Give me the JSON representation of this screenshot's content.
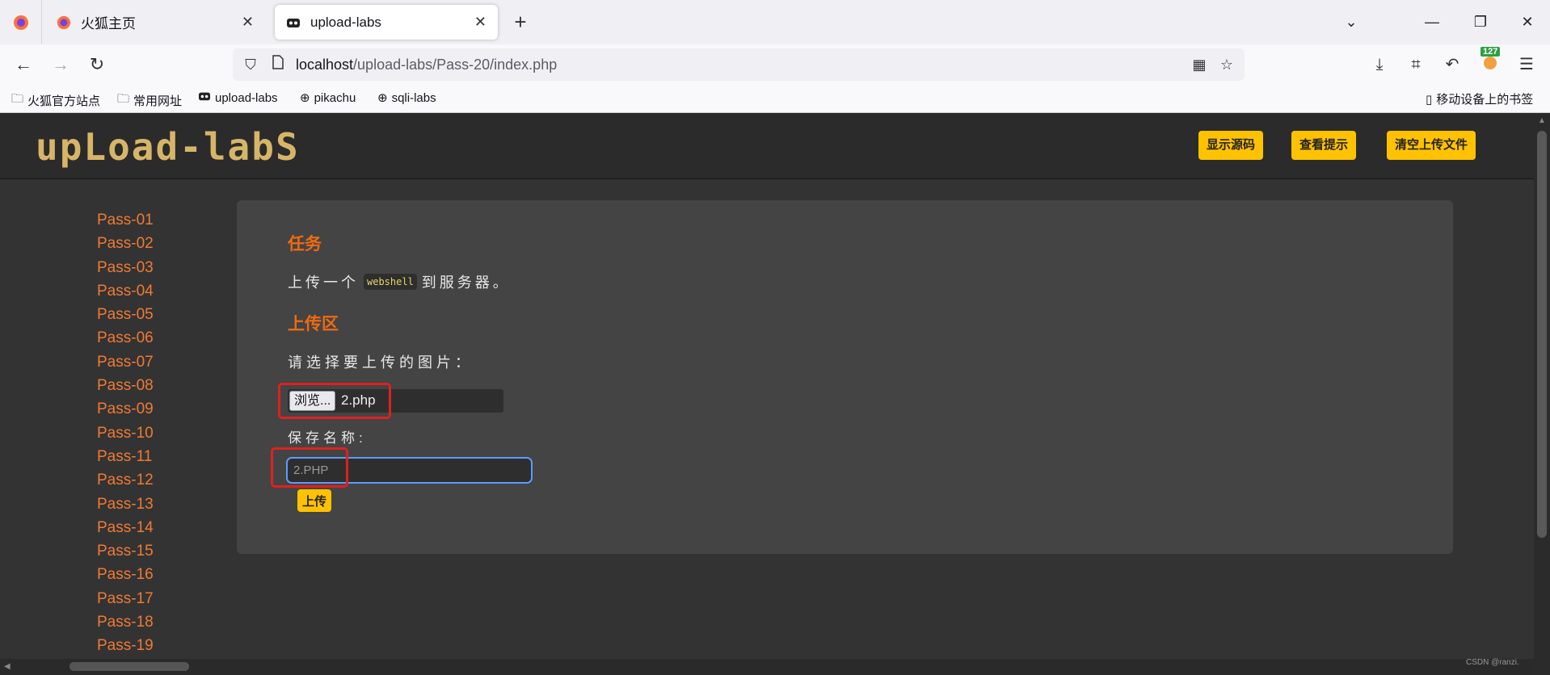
{
  "tabs": [
    {
      "title": "火狐主页",
      "icon": "firefox-icon"
    },
    {
      "title": "upload-labs",
      "icon": "game-icon"
    }
  ],
  "url": {
    "host": "localhost",
    "path": "/upload-labs/Pass-20/index.php"
  },
  "toolbar": {
    "badge_count": "127"
  },
  "bookmarks": [
    {
      "label": "火狐官方站点",
      "icon": "folder-icon"
    },
    {
      "label": "常用网址",
      "icon": "folder-icon"
    },
    {
      "label": "upload-labs",
      "icon": "game-icon"
    },
    {
      "label": "pikachu",
      "icon": "globe-icon"
    },
    {
      "label": "sqli-labs",
      "icon": "globe-icon"
    }
  ],
  "mobile_bookmarks": "移动设备上的书签",
  "header": {
    "logo": "upLoad-labS",
    "buttons": [
      "显示源码",
      "查看提示",
      "清空上传文件"
    ]
  },
  "sidebar": {
    "items": [
      "Pass-01",
      "Pass-02",
      "Pass-03",
      "Pass-04",
      "Pass-05",
      "Pass-06",
      "Pass-07",
      "Pass-08",
      "Pass-09",
      "Pass-10",
      "Pass-11",
      "Pass-12",
      "Pass-13",
      "Pass-14",
      "Pass-15",
      "Pass-16",
      "Pass-17",
      "Pass-18",
      "Pass-19"
    ]
  },
  "main": {
    "task_heading": "任务",
    "task_prefix": "上传一个",
    "task_code": "webshell",
    "task_suffix": "到服务器。",
    "upload_heading": "上传区",
    "choose_label": "请选择要上传的图片：",
    "browse_label": "浏览...",
    "file_name": "2.php",
    "save_label": "保存名称:",
    "save_value": "2.PHP",
    "upload_button": "上传"
  },
  "watermark": "CSDN @ranzi.",
  "colors": {
    "accent_yellow": "#ffc200",
    "heading_orange": "#f06a10",
    "link_orange": "#f07a35",
    "highlight_red": "#e02020"
  }
}
